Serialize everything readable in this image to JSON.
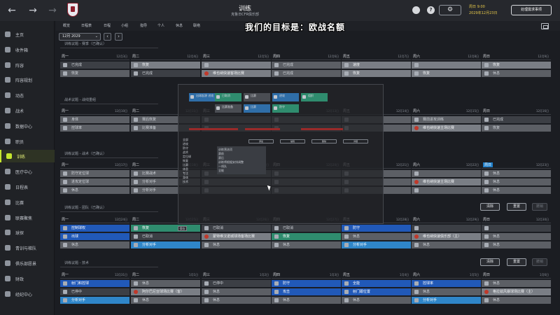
{
  "header": {
    "title": "训练",
    "subtitle": "克鲁日CFR俱乐部",
    "date_line1": "周日 9:00",
    "date_line2": "2029年12月23日",
    "continue_label": "处理需求事项",
    "help_glyph": "?",
    "settings_glyph": "⚙"
  },
  "caption": "我们的目标是：欧战名额",
  "sidebar": {
    "items": [
      {
        "label": "主页"
      },
      {
        "label": "收件箱"
      },
      {
        "label": "阵容"
      },
      {
        "label": "阵容规划"
      },
      {
        "label": "动态"
      },
      {
        "label": "战术"
      },
      {
        "label": "数据中心"
      },
      {
        "label": "职员"
      },
      {
        "label": "训练",
        "active": true
      },
      {
        "label": "医疗中心"
      },
      {
        "label": "日程表"
      },
      {
        "label": "比赛"
      },
      {
        "label": "联赛聚焦"
      },
      {
        "label": "球探"
      },
      {
        "label": "青训与梯队"
      },
      {
        "label": "俱乐部愿景"
      },
      {
        "label": "财政"
      },
      {
        "label": "经纪中心"
      }
    ]
  },
  "tabs": [
    "概览",
    "日程表",
    "日程",
    "小组",
    "指导",
    "个人",
    "休息",
    "联络"
  ],
  "month_select": "12月 2029",
  "pager": {
    "prev": "‹",
    "next": "›"
  },
  "groups": [
    {
      "label": "训练议题 - 赛季（已确认）"
    },
    {
      "label": "战术议题 - 战线重组"
    },
    {
      "label": "训练议题 - 战术（已确认）"
    },
    {
      "label": "训练议题 - 团队（已确认）",
      "buttons": [
        "清除",
        "重置",
        "撤销"
      ]
    },
    {
      "label": "训练议题 - 技术",
      "buttons": [
        "清除",
        "重置",
        "撤销"
      ]
    }
  ],
  "weeks": [
    {
      "days": [
        {
          "name": "周一",
          "date": "12月3日"
        },
        {
          "name": "周二",
          "date": "12月4日"
        },
        {
          "name": "周三",
          "date": "12月5日"
        },
        {
          "name": "周四",
          "date": "12月6日"
        },
        {
          "name": "周五",
          "date": "12月7日"
        },
        {
          "name": "周六",
          "date": "12月8日"
        },
        {
          "name": "周日",
          "date": "12月9日"
        }
      ],
      "rows": [
        [
          {
            "t": "已完成",
            "c": "c-dgray"
          },
          {
            "t": "恢复",
            "c": "c-light"
          },
          {
            "t": "",
            "c": "c-light"
          },
          {
            "t": "已完成",
            "c": "c-gray"
          },
          {
            "t": "速度",
            "c": "c-light"
          },
          {
            "t": "",
            "c": "c-light"
          },
          {
            "t": "恢复",
            "c": "c-light"
          }
        ],
        [
          {
            "t": "恢复",
            "c": "c-gray"
          },
          {
            "t": "已完成",
            "c": "c-dgray"
          },
          {
            "t": "维也纳快速客场比赛",
            "c": "c-light c-red"
          },
          {
            "t": "已完成",
            "c": "c-gray"
          },
          {
            "t": "恢复",
            "c": "c-light"
          },
          {
            "t": "恢复",
            "c": "c-light"
          },
          {
            "t": "休息",
            "c": "c-gray"
          }
        ]
      ]
    },
    {
      "days": [
        {
          "name": "周一",
          "date": "12月10日"
        },
        {
          "name": "周二",
          "date": "12月11日"
        },
        {
          "name": "周三",
          "date": "12月12日"
        },
        {
          "name": "周四",
          "date": "12月13日"
        },
        {
          "name": "周五",
          "date": "12月14日"
        },
        {
          "name": "周六",
          "date": "12月15日"
        },
        {
          "name": "周日",
          "date": "12月16日"
        }
      ],
      "rows": [
        [
          {
            "t": "身体",
            "c": "c-gray"
          },
          {
            "t": "赛后恢复",
            "c": "c-gray"
          },
          {
            "t": "",
            "c": "c-gray"
          },
          {
            "t": "",
            "c": "c-gray"
          },
          {
            "t": "",
            "c": "c-gray"
          },
          {
            "t": "赛前进攻训练",
            "c": "c-gray"
          },
          {
            "t": "已完成",
            "c": "c-dgray"
          }
        ],
        [
          {
            "t": "控球率",
            "c": "c-gray"
          },
          {
            "t": "比赛准备",
            "c": "c-gray"
          },
          {
            "t": "",
            "c": "c-gray"
          },
          {
            "t": "",
            "c": "c-gray"
          },
          {
            "t": "",
            "c": "c-gray"
          },
          {
            "t": "维也纳快速主场比赛",
            "c": "c-light c-red"
          },
          {
            "t": "恢复",
            "c": "c-gray"
          }
        ]
      ]
    },
    {
      "days": [
        {
          "name": "周一",
          "date": "12月17日"
        },
        {
          "name": "周二",
          "date": "12月18日"
        },
        {
          "name": "周三",
          "date": "12月19日"
        },
        {
          "name": "周四",
          "date": "12月20日"
        },
        {
          "name": "周五",
          "date": "12月21日"
        },
        {
          "name": "周六",
          "date": "12月22日"
        },
        {
          "name": "周日",
          "date": "12月23日",
          "today": true
        }
      ],
      "rows": [
        [
          {
            "t": "防守定位球",
            "c": "c-gray"
          },
          {
            "t": "比赛战术",
            "c": "c-gray"
          },
          {
            "t": "",
            "c": "c-gray"
          },
          {
            "t": "",
            "c": "c-gray"
          },
          {
            "t": "",
            "c": "c-gray"
          },
          {
            "t": "",
            "c": "c-gray"
          },
          {
            "t": "休息",
            "c": "c-gray"
          }
        ],
        [
          {
            "t": "进攻定位球",
            "c": "c-gray"
          },
          {
            "t": "分析对手",
            "c": "c-gray"
          },
          {
            "t": "",
            "c": "c-gray"
          },
          {
            "t": "",
            "c": "c-gray"
          },
          {
            "t": "",
            "c": "c-gray"
          },
          {
            "t": "维也纳快速主场比赛",
            "c": "c-light c-red"
          },
          {
            "t": "休息",
            "c": "c-gray"
          }
        ],
        [
          {
            "t": "休息",
            "c": "c-gray"
          },
          {
            "t": "分析对手",
            "c": "c-gray"
          },
          {
            "t": "",
            "c": "c-gray"
          },
          {
            "t": "",
            "c": "c-gray"
          },
          {
            "t": "",
            "c": "c-gray"
          },
          {
            "t": "",
            "c": "c-gray"
          },
          {
            "t": "休息",
            "c": "c-gray"
          }
        ]
      ]
    },
    {
      "days": [
        {
          "name": "周一",
          "date": "12月24日"
        },
        {
          "name": "周二",
          "date": "12月25日"
        },
        {
          "name": "周三",
          "date": "12月26日"
        },
        {
          "name": "周四",
          "date": "12月27日"
        },
        {
          "name": "周五",
          "date": "12月28日"
        },
        {
          "name": "周六",
          "date": "12月29日"
        },
        {
          "name": "周日",
          "date": "12月30日"
        }
      ],
      "rows": [
        [
          {
            "t": "控制球权",
            "c": "c-blue"
          },
          {
            "t": "恢复",
            "c": "c-teal"
          },
          {
            "t": "已取消",
            "c": "c-dgray"
          },
          {
            "t": "已取消",
            "c": "c-dgray"
          },
          {
            "t": "防守",
            "c": "c-blue"
          },
          {
            "t": "",
            "c": "c-dgray"
          },
          {
            "t": "",
            "c": "c-dgray"
          }
        ],
        [
          {
            "t": "出球",
            "c": "c-blue"
          },
          {
            "t": "已取消",
            "c": "c-dgray"
          },
          {
            "t": "蒙特维汉诺城球场客场比赛",
            "c": "c-light c-red"
          },
          {
            "t": "恢复",
            "c": "c-teal"
          },
          {
            "t": "休息",
            "c": "c-gray"
          },
          {
            "t": "维也纳快速俱乐部（主）",
            "c": "c-light c-red"
          },
          {
            "t": "休息",
            "c": "c-gray"
          }
        ],
        [
          {
            "t": "休息",
            "c": "c-gray"
          },
          {
            "t": "分析对手",
            "c": "c-lblue"
          },
          {
            "t": "休息",
            "c": "c-gray"
          },
          {
            "t": "休息",
            "c": "c-gray"
          },
          {
            "t": "分析对手",
            "c": "c-lblue"
          },
          {
            "t": "休息",
            "c": "c-gray"
          },
          {
            "t": "休息",
            "c": "c-gray"
          }
        ]
      ]
    },
    {
      "days": [
        {
          "name": "周一",
          "date": "12月31日"
        },
        {
          "name": "周二",
          "date": "1月1日"
        },
        {
          "name": "周三",
          "date": "1月2日"
        },
        {
          "name": "周四",
          "date": "1月3日"
        },
        {
          "name": "周五",
          "date": "1月4日"
        },
        {
          "name": "周六",
          "date": "1月5日"
        },
        {
          "name": "周日",
          "date": "1月6日"
        }
      ],
      "rows": [
        [
          {
            "t": "射门和控球",
            "c": "c-blue"
          },
          {
            "t": "休息",
            "c": "c-gray"
          },
          {
            "t": "已停中",
            "c": "c-dgray"
          },
          {
            "t": "防守",
            "c": "c-blue"
          },
          {
            "t": "全能",
            "c": "c-blue"
          },
          {
            "t": "控球率",
            "c": "c-blue"
          },
          {
            "t": "休息",
            "c": "c-gray"
          }
        ],
        [
          {
            "t": "已停中",
            "c": "c-dgray"
          },
          {
            "t": "阿尔巴尼亚球场比赛（客）",
            "c": "c-light c-red"
          },
          {
            "t": "休息",
            "c": "c-gray"
          },
          {
            "t": "攻击",
            "c": "c-blue"
          },
          {
            "t": "射门跟位置",
            "c": "c-blue"
          },
          {
            "t": "休息",
            "c": "c-gray"
          },
          {
            "t": "格拉兹风暴球场比赛（主）",
            "c": "c-light c-red"
          }
        ],
        [
          {
            "t": "分析对手",
            "c": "c-lblue"
          },
          {
            "t": "休息",
            "c": "c-gray"
          },
          {
            "t": "休息",
            "c": "c-gray"
          },
          {
            "t": "休息",
            "c": "c-gray"
          },
          {
            "t": "休息",
            "c": "c-gray"
          },
          {
            "t": "分析对手",
            "c": "c-lblue"
          },
          {
            "t": "休息",
            "c": "c-gray"
          }
        ]
      ]
    }
  ],
  "overlay": {
    "cells": [
      {
        "t": "出球起源 进攻"
      },
      {
        "t": "已取消"
      },
      {
        "t": "比赛"
      },
      {
        "t": "进攻"
      },
      {
        "t": "组织"
      },
      {
        "t": "比赛准备"
      },
      {
        "t": "比赛"
      },
      {
        "t": "防守"
      }
    ],
    "buttons": [
      "添加",
      "编辑",
      "删除",
      "详细"
    ],
    "list": [
      "全部",
      "进攻",
      "防守",
      "战术",
      "定位球",
      "恢复",
      "比赛",
      "休息",
      "专注",
      "身体",
      "技术"
    ],
    "popup": [
      "训练营选项",
      "赛前",
      "赛后",
      "训练将根据安排调整",
      "一线队",
      "全能"
    ],
    "tag": "保存"
  }
}
